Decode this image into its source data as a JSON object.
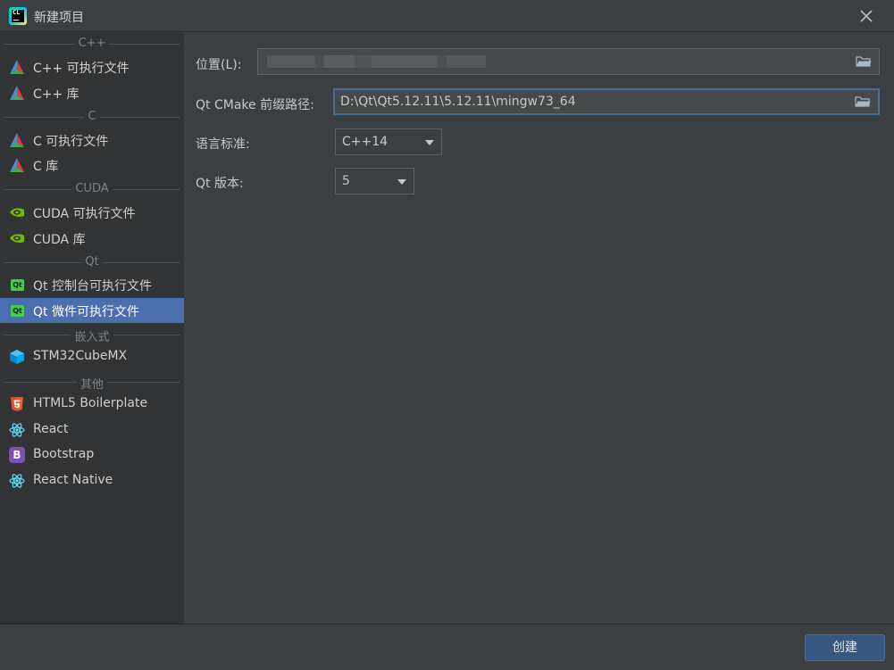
{
  "window": {
    "title": "新建项目",
    "logo_text": "CL"
  },
  "sidebar": {
    "sections": [
      {
        "label": "C++",
        "items": [
          {
            "label": "C++ 可执行文件",
            "icon": "cmake-triangle-icon"
          },
          {
            "label": "C++ 库",
            "icon": "cmake-triangle-icon"
          }
        ]
      },
      {
        "label": "C",
        "items": [
          {
            "label": "C 可执行文件",
            "icon": "cmake-triangle-icon"
          },
          {
            "label": "C 库",
            "icon": "cmake-triangle-icon"
          }
        ]
      },
      {
        "label": "CUDA",
        "items": [
          {
            "label": "CUDA 可执行文件",
            "icon": "nvidia-icon"
          },
          {
            "label": "CUDA 库",
            "icon": "nvidia-icon"
          }
        ]
      },
      {
        "label": "Qt",
        "items": [
          {
            "label": "Qt 控制台可执行文件",
            "icon": "qt-icon",
            "badge": "Qt"
          },
          {
            "label": "Qt 微件可执行文件",
            "icon": "qt-icon",
            "badge": "Qt",
            "selected": true
          }
        ]
      },
      {
        "label": "嵌入式",
        "items": [
          {
            "label": "STM32CubeMX",
            "icon": "stm32-cube-icon"
          }
        ]
      },
      {
        "label": "其他",
        "items": [
          {
            "label": "HTML5 Boilerplate",
            "icon": "html5-icon"
          },
          {
            "label": "React",
            "icon": "react-icon"
          },
          {
            "label": "Bootstrap",
            "icon": "bootstrap-icon",
            "badge": "B"
          },
          {
            "label": "React Native",
            "icon": "react-icon"
          }
        ]
      }
    ]
  },
  "form": {
    "location_label": "位置(L):",
    "location_value": "",
    "qt_prefix_label": "Qt CMake 前缀路径:",
    "qt_prefix_value": "D:\\Qt\\Qt5.12.11\\5.12.11\\mingw73_64",
    "lang_label": "语言标准:",
    "lang_value": "C++14",
    "qt_version_label": "Qt 版本:",
    "qt_version_value": "5"
  },
  "footer": {
    "create_label": "创建"
  },
  "colors": {
    "selection": "#4b6eaf",
    "qt_green": "#41cd52",
    "nvidia_green": "#76b900",
    "primary_button": "#365880"
  }
}
